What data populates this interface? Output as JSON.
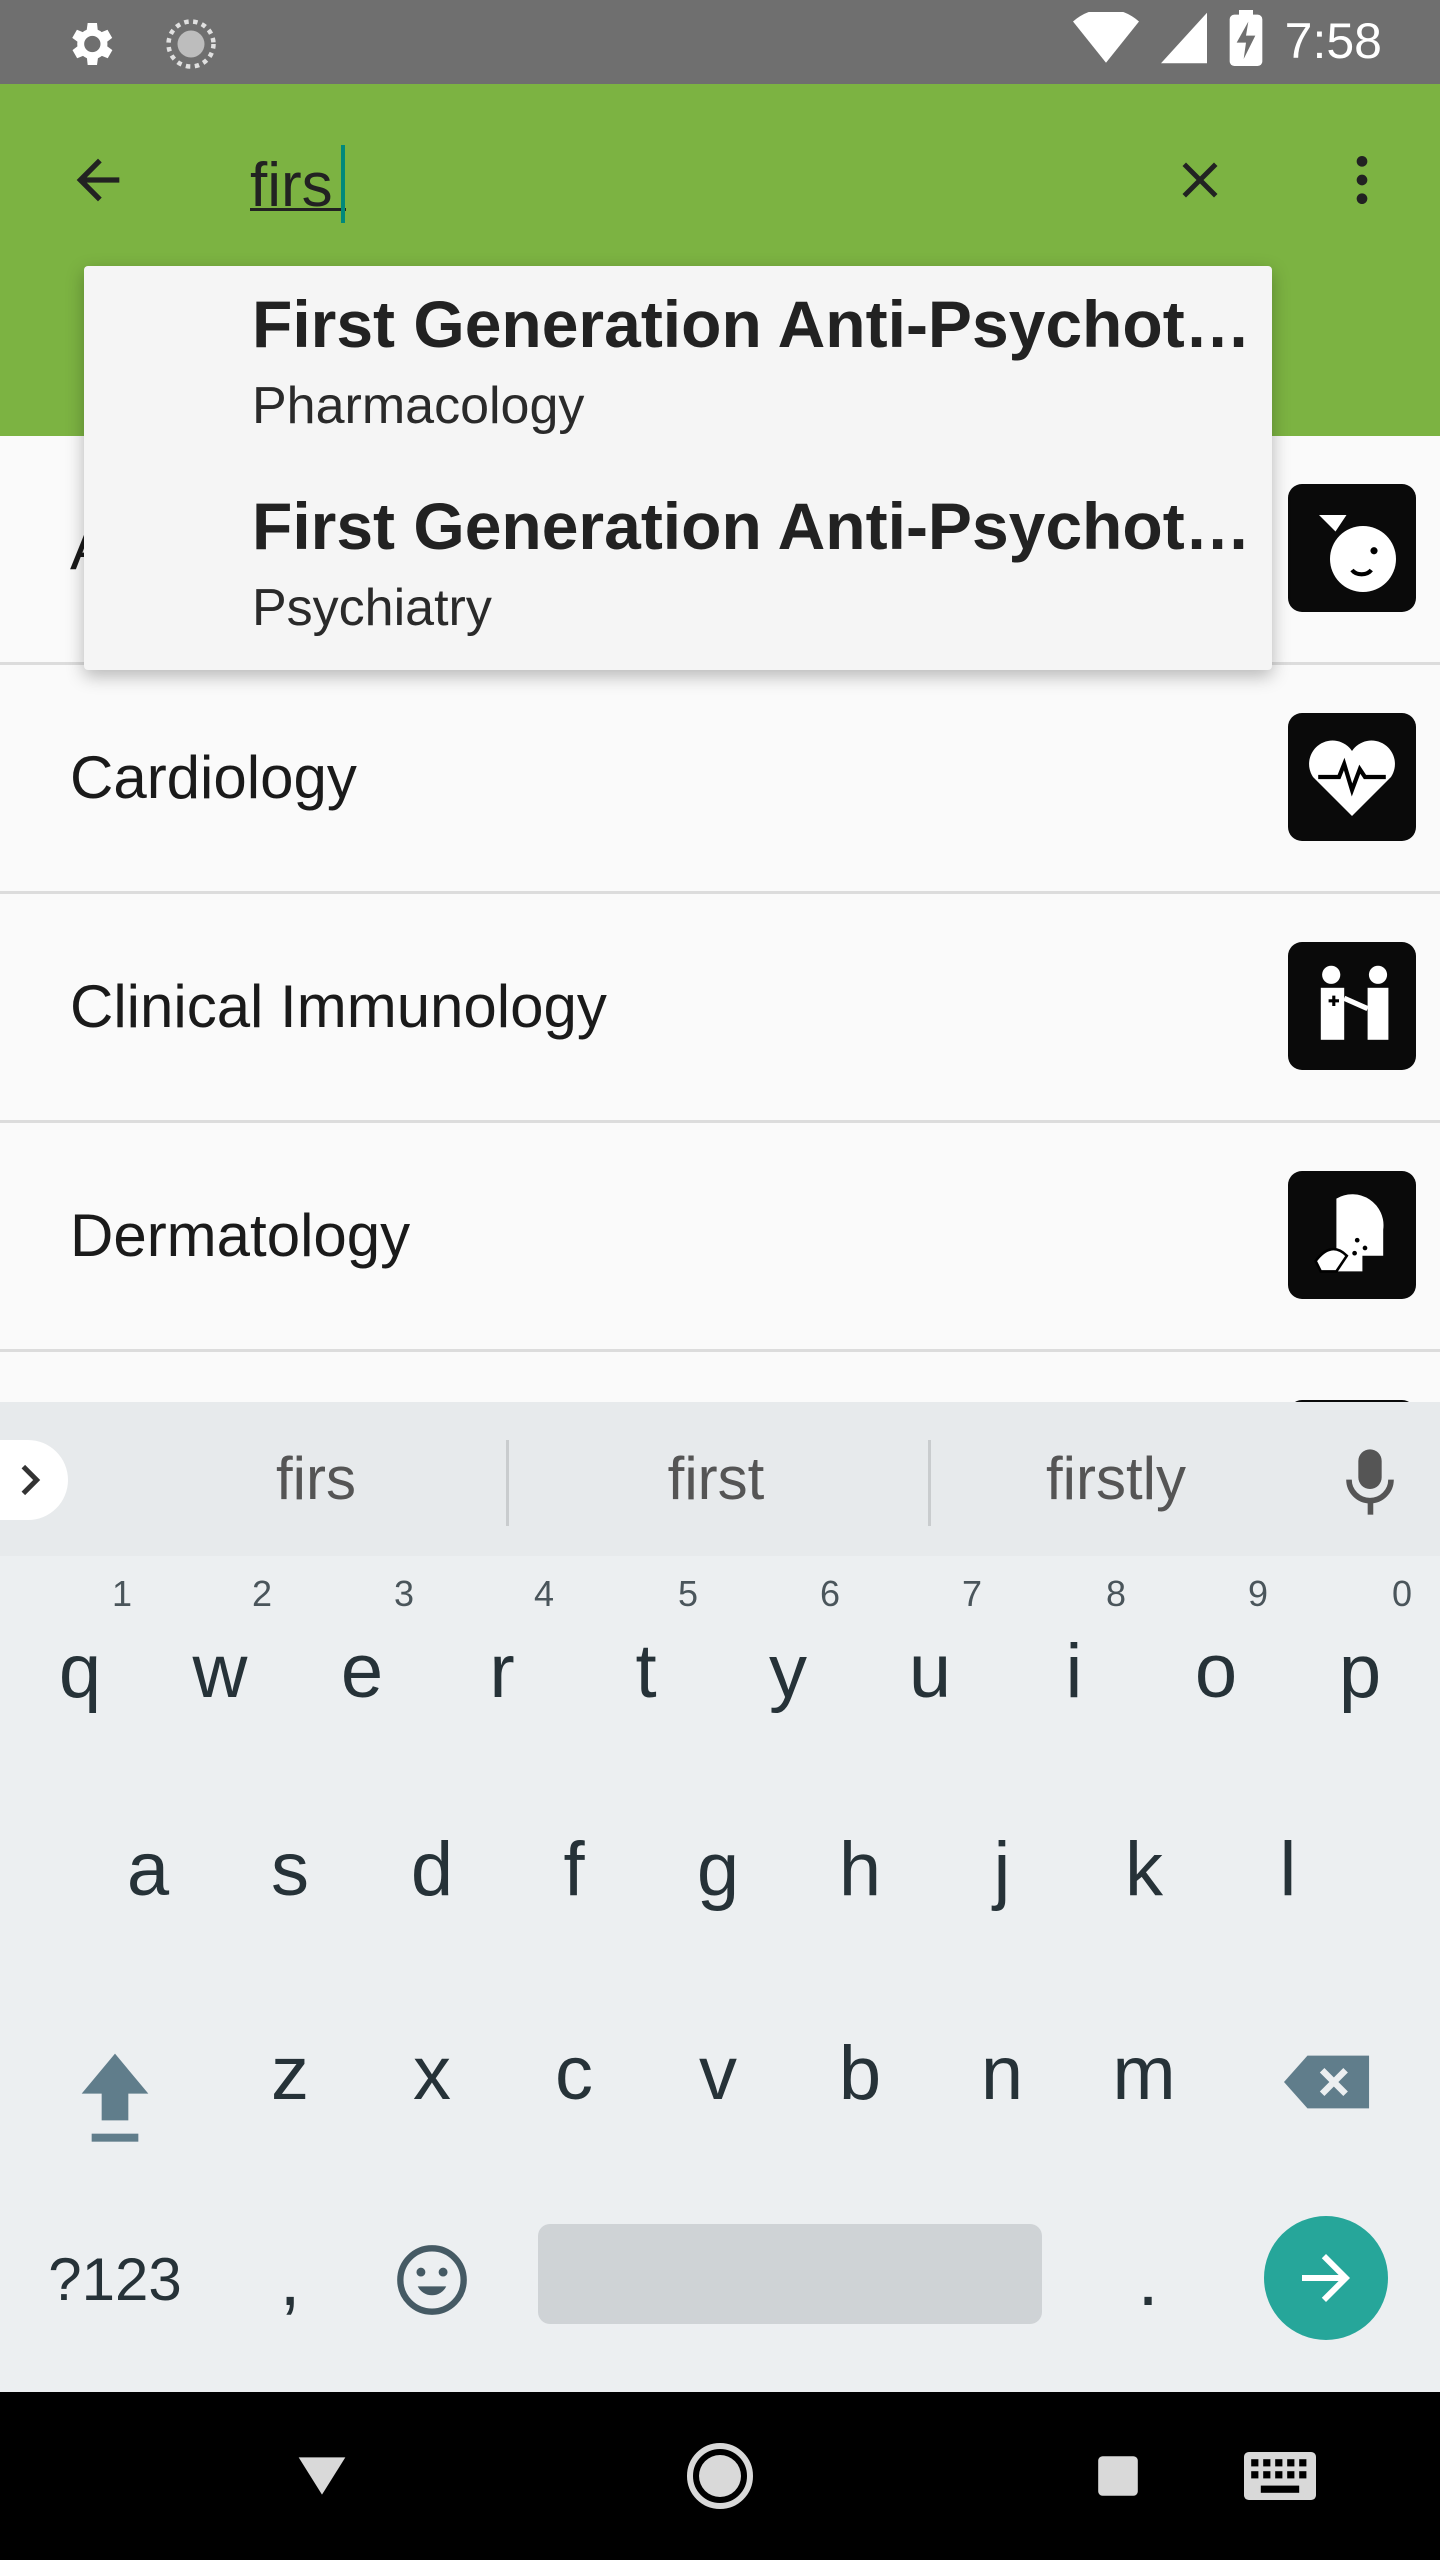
{
  "status_bar": {
    "time": "7:58",
    "icons": [
      "settings-icon",
      "sync-icon",
      "wifi-icon",
      "signal-icon",
      "battery-charging-icon"
    ]
  },
  "app_bar": {
    "color": "#7cb342",
    "search_value": "firs",
    "back_icon": "arrow-back-icon",
    "clear_icon": "close-icon",
    "overflow_icon": "more-vert-icon"
  },
  "suggestions": [
    {
      "title": "First Generation Anti-Psychotics",
      "subtitle": "Pharmacology"
    },
    {
      "title": "First Generation Anti-Psychotics",
      "subtitle": "Psychiatry"
    }
  ],
  "list": {
    "items": [
      {
        "label": "A",
        "icon": "anesthesia-icon"
      },
      {
        "label": "Cardiology",
        "icon": "heart-icon"
      },
      {
        "label": "Clinical Immunology",
        "icon": "immunology-icon"
      },
      {
        "label": "Dermatology",
        "icon": "dermatology-icon"
      }
    ]
  },
  "keyboard": {
    "suggestions": [
      "firs",
      "first",
      "firstly"
    ],
    "row1": [
      {
        "k": "q",
        "n": "1"
      },
      {
        "k": "w",
        "n": "2"
      },
      {
        "k": "e",
        "n": "3"
      },
      {
        "k": "r",
        "n": "4"
      },
      {
        "k": "t",
        "n": "5"
      },
      {
        "k": "y",
        "n": "6"
      },
      {
        "k": "u",
        "n": "7"
      },
      {
        "k": "i",
        "n": "8"
      },
      {
        "k": "o",
        "n": "9"
      },
      {
        "k": "p",
        "n": "0"
      }
    ],
    "row2": [
      "a",
      "s",
      "d",
      "f",
      "g",
      "h",
      "j",
      "k",
      "l"
    ],
    "row3": [
      "z",
      "x",
      "c",
      "v",
      "b",
      "n",
      "m"
    ],
    "symbols_label": "?123",
    "comma": ",",
    "period": ".",
    "enter_color": "#26a69a"
  },
  "nav_bar": {
    "icons": [
      "back-triangle-icon",
      "home-circle-icon",
      "recents-square-icon",
      "keyboard-icon"
    ]
  }
}
